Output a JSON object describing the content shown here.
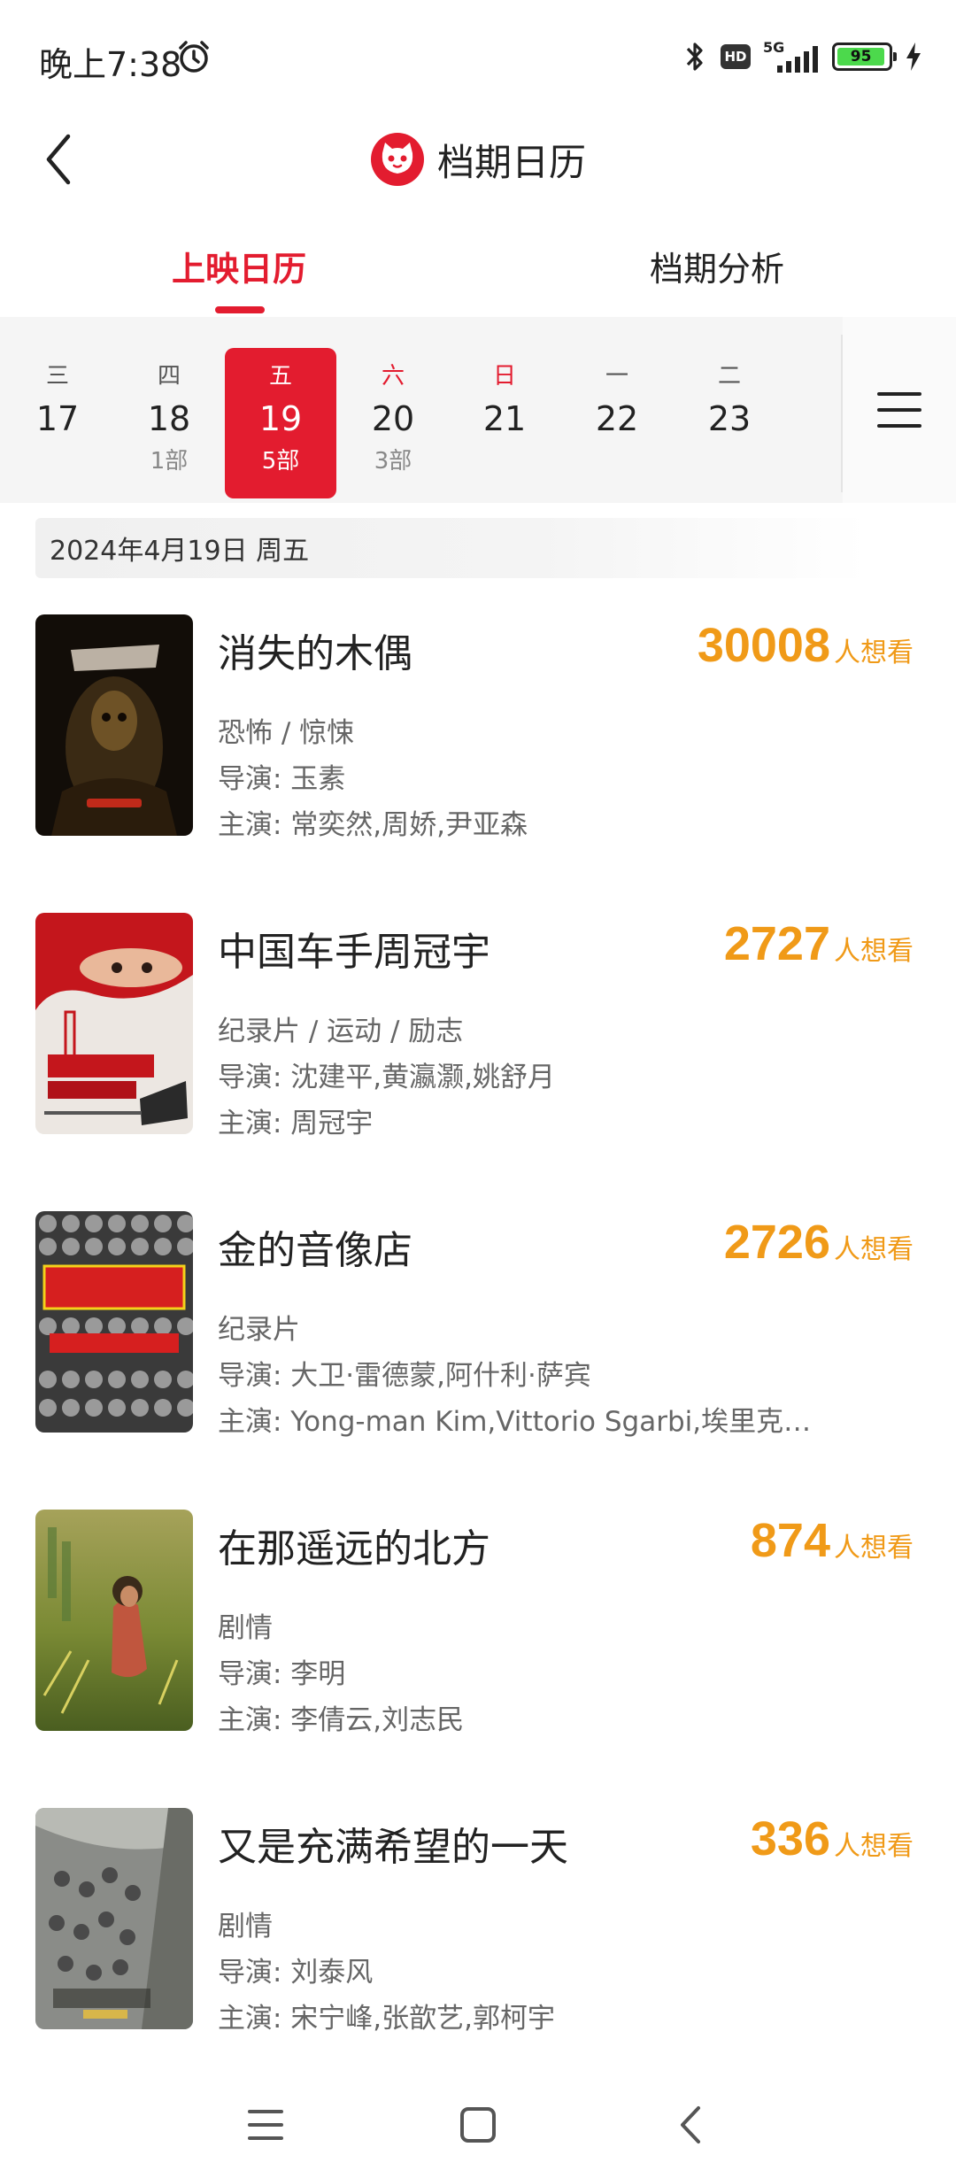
{
  "status": {
    "time": "晚上7:38",
    "hd": "HD",
    "network": "5G",
    "battery": "95",
    "battery_level": 0.95
  },
  "header": {
    "title": "档期日历"
  },
  "tabs": [
    {
      "label": "上映日历",
      "active": true
    },
    {
      "label": "档期分析",
      "active": false
    }
  ],
  "date_strip": [
    {
      "weekday": "三",
      "day": "17",
      "count": ""
    },
    {
      "weekday": "四",
      "day": "18",
      "count": "1部"
    },
    {
      "weekday": "五",
      "day": "19",
      "count": "5部",
      "selected": true
    },
    {
      "weekday": "六",
      "day": "20",
      "count": "3部",
      "weekend": true
    },
    {
      "weekday": "日",
      "day": "21",
      "count": "",
      "weekend": true
    },
    {
      "weekday": "一",
      "day": "22",
      "count": ""
    },
    {
      "weekday": "二",
      "day": "23",
      "count": ""
    }
  ],
  "selected_date": "2024年4月19日  周五",
  "want_suffix": "人想看",
  "movies": [
    {
      "title": "消失的木偶",
      "want": "30008",
      "genre": "恐怖 / 惊悚",
      "director": "导演: 玉素",
      "stars": "主演: 常奕然,周娇,尹亚森",
      "poster_icon": "horror-poster"
    },
    {
      "title": "中国车手周冠宇",
      "want": "2727",
      "genre": "纪录片 / 运动 / 励志",
      "director": "导演: 沈建平,黄瀛灏,姚舒月",
      "stars": "主演: 周冠宇",
      "poster_icon": "racing-poster"
    },
    {
      "title": "金的音像店",
      "want": "2726",
      "genre": "纪录片",
      "director": "导演: 大卫·雷德蒙,阿什利·萨宾",
      "stars": "主演: Yong-man Kim,Vittorio Sgarbi,埃里克…",
      "poster_icon": "video-store-poster"
    },
    {
      "title": "在那遥远的北方",
      "want": "874",
      "genre": "剧情",
      "director": "导演: 李明",
      "stars": "主演: 李倩云,刘志民",
      "poster_icon": "field-poster"
    },
    {
      "title": "又是充满希望的一天",
      "want": "336",
      "genre": "剧情",
      "director": "导演: 刘泰风",
      "stars": "主演: 宋宁峰,张歆艺,郭柯宇",
      "poster_icon": "street-poster"
    }
  ],
  "colors": {
    "accent": "#e31c2f",
    "want": "#f09a18"
  }
}
